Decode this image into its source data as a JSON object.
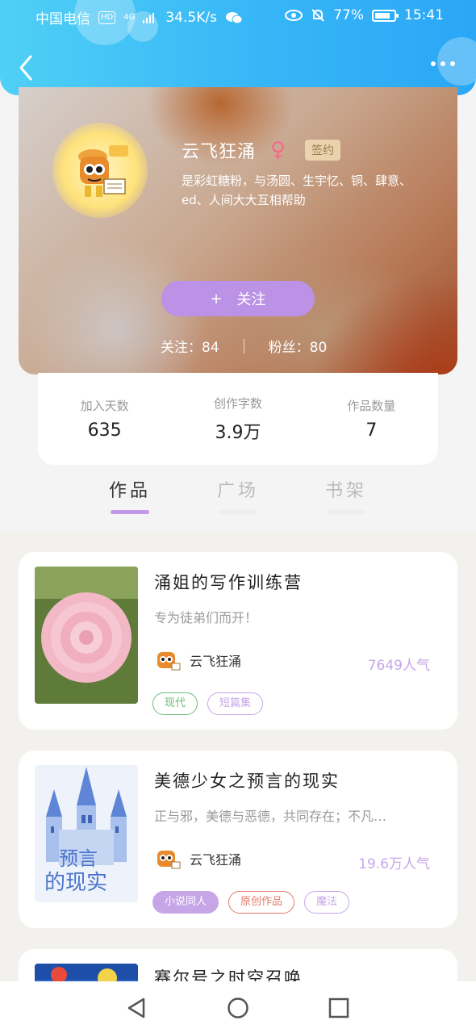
{
  "status_bar": {
    "carrier": "中国电信",
    "hd": "HD",
    "network": "4G",
    "speed": "34.5K/s",
    "battery": "77%",
    "time": "15:41"
  },
  "profile": {
    "name": "云飞狂涌",
    "gender_symbol": "♀",
    "signed_badge": "签约",
    "bio": "是彩虹糖粉，与汤圆、生宇忆、铜、肆意、ed、人间大大互相帮助",
    "follow_button": "关注",
    "follow_plus": "+",
    "following_label": "关注：",
    "following_count": "84",
    "fans_label": "粉丝：",
    "fans_count": "80"
  },
  "stats": [
    {
      "label": "加入天数",
      "value": "635"
    },
    {
      "label": "创作字数",
      "value": "3.9万"
    },
    {
      "label": "作品数量",
      "value": "7"
    }
  ],
  "tabs": [
    {
      "label": "作品",
      "active": true
    },
    {
      "label": "广场",
      "active": false
    },
    {
      "label": "书架",
      "active": false
    }
  ],
  "works": [
    {
      "title": "涌姐的写作训练营",
      "desc": "专为徒弟们而开！",
      "author": "云飞狂涌",
      "popularity": "7649人气",
      "tags": [
        {
          "label": "现代",
          "color": "#6abf79"
        },
        {
          "label": "短篇集",
          "color": "#c7a6e8"
        }
      ]
    },
    {
      "title": "美德少女之预言的现实",
      "desc": "正与邪，美德与恶德，共同存在；不凡…",
      "author": "云飞狂涌",
      "popularity": "19.6万人气",
      "tags": [
        {
          "label": "小说同人",
          "color": "#c7a6e8",
          "filled": true
        },
        {
          "label": "原创作品",
          "color": "#e27d6d"
        },
        {
          "label": "魔法",
          "color": "#c7a6e8"
        }
      ]
    },
    {
      "title": "赛尔号之时空召唤"
    }
  ],
  "cover_text": {
    "book2_line1": "预言",
    "book2_line2": "的现实"
  },
  "colors": {
    "header_start": "#4fd0f5",
    "header_end": "#2aa7f6",
    "accent_purple": "#bb92e5",
    "tab_underline_active": "#c39ae8"
  }
}
